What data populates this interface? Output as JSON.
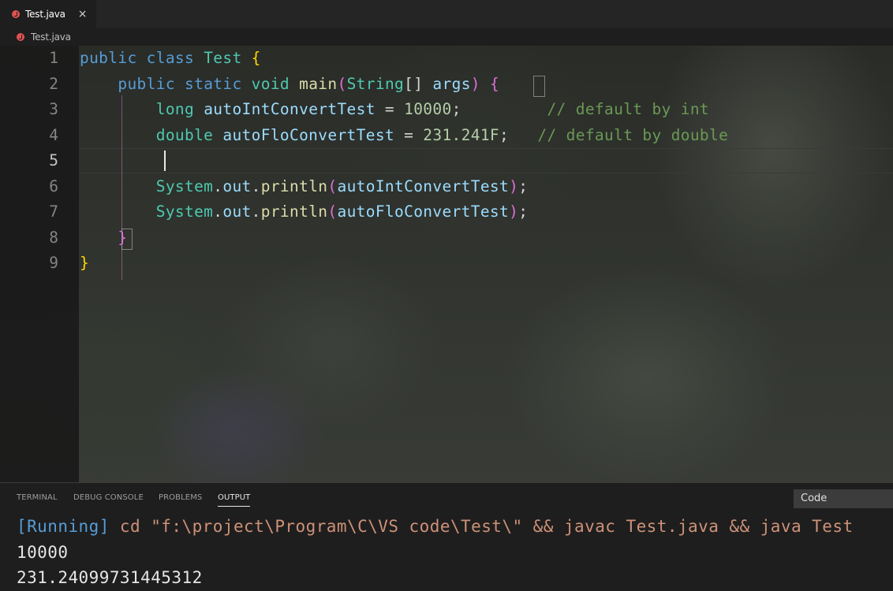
{
  "tabs": [
    {
      "label": "Test.java",
      "icon": "java-icon",
      "close": "×"
    }
  ],
  "breadcrumb": {
    "label": "Test.java",
    "icon": "java-icon"
  },
  "editor": {
    "line_numbers": [
      "1",
      "2",
      "3",
      "4",
      "5",
      "6",
      "7",
      "8",
      "9"
    ],
    "active_line": "5",
    "lines": [
      [
        [
          "kw",
          "public"
        ],
        [
          "pl",
          " "
        ],
        [
          "kw",
          "class"
        ],
        [
          "pl",
          " "
        ],
        [
          "ty",
          "Test"
        ],
        [
          "pl",
          " "
        ],
        [
          "b1",
          "{"
        ]
      ],
      [
        [
          "pl",
          "    "
        ],
        [
          "kw",
          "public"
        ],
        [
          "pl",
          " "
        ],
        [
          "kw",
          "static"
        ],
        [
          "pl",
          " "
        ],
        [
          "ty",
          "void"
        ],
        [
          "pl",
          " "
        ],
        [
          "fn",
          "main"
        ],
        [
          "b2",
          "("
        ],
        [
          "ty",
          "String"
        ],
        [
          "pl",
          "[] "
        ],
        [
          "va",
          "args"
        ],
        [
          "b2",
          ")"
        ],
        [
          "pl",
          " "
        ],
        [
          "b2",
          "{"
        ]
      ],
      [
        [
          "pl",
          "        "
        ],
        [
          "ty",
          "long"
        ],
        [
          "pl",
          " "
        ],
        [
          "va",
          "autoIntConvertTest"
        ],
        [
          "pl",
          " = "
        ],
        [
          "nu",
          "10000"
        ],
        [
          "pl",
          ";         "
        ],
        [
          "cm",
          "// default by int"
        ]
      ],
      [
        [
          "pl",
          "        "
        ],
        [
          "ty",
          "double"
        ],
        [
          "pl",
          " "
        ],
        [
          "va",
          "autoFloConvertTest"
        ],
        [
          "pl",
          " = "
        ],
        [
          "nu",
          "231.241F"
        ],
        [
          "pl",
          ";   "
        ],
        [
          "cm",
          "// default by double"
        ]
      ],
      [
        [
          "pl",
          ""
        ]
      ],
      [
        [
          "pl",
          "        "
        ],
        [
          "ty",
          "System"
        ],
        [
          "pl",
          "."
        ],
        [
          "va",
          "out"
        ],
        [
          "pl",
          "."
        ],
        [
          "fn",
          "println"
        ],
        [
          "b2",
          "("
        ],
        [
          "va",
          "autoIntConvertTest"
        ],
        [
          "b2",
          ")"
        ],
        [
          "pl",
          ";"
        ]
      ],
      [
        [
          "pl",
          "        "
        ],
        [
          "ty",
          "System"
        ],
        [
          "pl",
          "."
        ],
        [
          "va",
          "out"
        ],
        [
          "pl",
          "."
        ],
        [
          "fn",
          "println"
        ],
        [
          "b2",
          "("
        ],
        [
          "va",
          "autoFloConvertTest"
        ],
        [
          "b2",
          ")"
        ],
        [
          "pl",
          ";"
        ]
      ],
      [
        [
          "pl",
          "    "
        ],
        [
          "b2",
          "}"
        ]
      ],
      [
        [
          "b1",
          "}"
        ]
      ]
    ]
  },
  "panel": {
    "tabs": [
      {
        "label": "TERMINAL",
        "active": false
      },
      {
        "label": "DEBUG CONSOLE",
        "active": false
      },
      {
        "label": "PROBLEMS",
        "active": false
      },
      {
        "label": "OUTPUT",
        "active": true
      }
    ],
    "channel": "Code",
    "output": {
      "running_tag": "[Running]",
      "command": " cd \"f:\\project\\Program\\C\\VS code\\Test\\\" && javac Test.java && java Test",
      "lines": [
        "10000",
        "231.24099731445312"
      ]
    }
  },
  "colors": {
    "keyword": "#569cd6",
    "type": "#4ec9b0",
    "function": "#dcdcaa",
    "variable": "#9cdcfe",
    "number": "#b5cea8",
    "comment": "#6a9955",
    "bracket_level1": "#ffd700",
    "bracket_level2": "#da70d6",
    "java_icon": "#e05252",
    "running_tag": "#569cd6",
    "command": "#ce9178"
  }
}
